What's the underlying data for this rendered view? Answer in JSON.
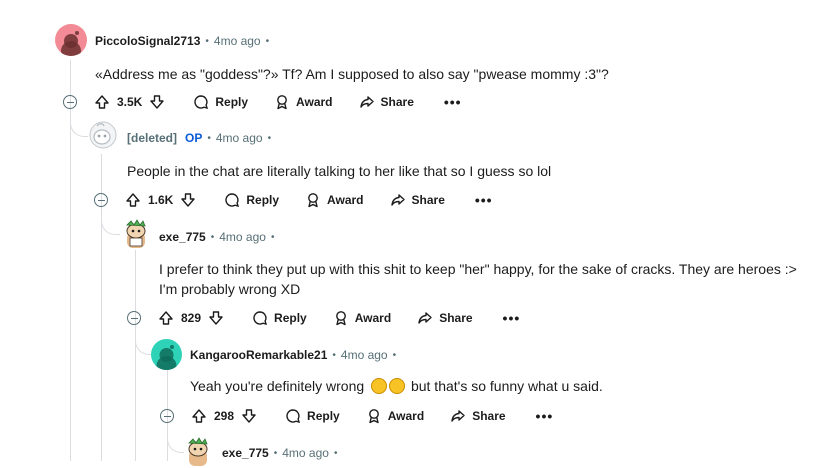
{
  "comments": [
    {
      "author": "PiccoloSignal2713",
      "time": "4mo ago",
      "text": "«Address me as \"goddess\"?» Tf? Am I supposed to also say \"pwease mommy :3\"?",
      "votes": "3.5K"
    },
    {
      "author": "[deleted]",
      "badge": "OP",
      "time": "4mo ago",
      "text": "People in the chat are literally talking to her like that so I guess so lol",
      "votes": "1.6K"
    },
    {
      "author": "exe_775",
      "time": "4mo ago",
      "text_line1": "I prefer to think they put up with this shit to keep \"her\" happy, for the sake of cracks. They are heroes :>",
      "text_line2": "I'm probably wrong XD",
      "votes": "829"
    },
    {
      "author": "KangarooRemarkable21",
      "time": "4mo ago",
      "text_before": "Yeah you're definitely wrong",
      "text_after": "but that's so funny what u said.",
      "votes": "298"
    },
    {
      "author": "exe_775",
      "time": "4mo ago"
    }
  ],
  "actions": {
    "reply": "Reply",
    "award": "Award",
    "share": "Share",
    "more": "•••"
  },
  "colors": {
    "avatar_pink": "#f28b95",
    "avatar_teal": "#2ed3b7",
    "op_blue": "#0a5ad8",
    "meta_gray": "#576f76",
    "thread_line": "#dadce0"
  }
}
